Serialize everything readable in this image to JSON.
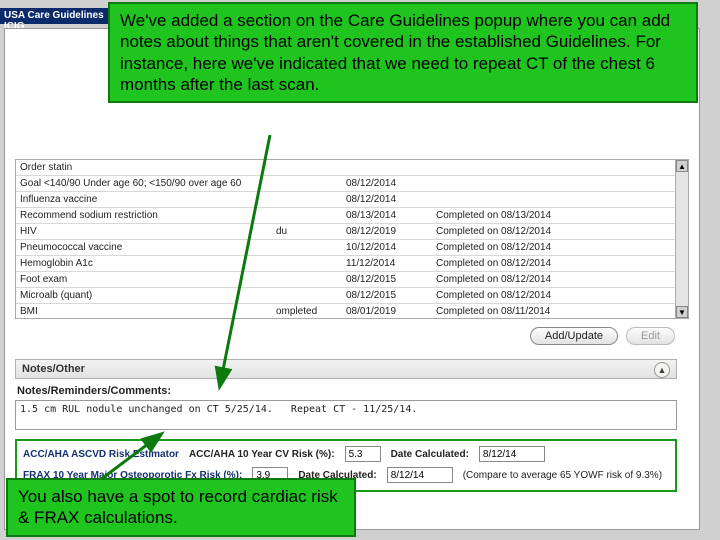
{
  "titlebar": "USA Care Guidelines ICIG",
  "callouts": {
    "top": "We've added a section on the Care Guidelines popup where you can add notes about things that aren't covered in the established Guidelines.  For instance, here we've indicated that we need to repeat CT of the chest 6 months after the last scan.",
    "bot": "You also have a spot to record cardiac risk & FRAX calculations."
  },
  "table_rows": [
    {
      "c1": "Order statin",
      "c2": "",
      "c3": "",
      "c4": ""
    },
    {
      "c1": "Goal <140/90 Under age 60; <150/90 over age 60",
      "c2": "",
      "c3": "08/12/2014",
      "c4": ""
    },
    {
      "c1": "Influenza vaccine",
      "c2": "",
      "c3": "08/12/2014",
      "c4": ""
    },
    {
      "c1": "Recommend sodium restriction",
      "c2": "",
      "c3": "08/13/2014",
      "c4": "Completed on 08/13/2014"
    },
    {
      "c1": "HIV",
      "c2": "du",
      "c3": "08/12/2019",
      "c4": "Completed on 08/12/2014"
    },
    {
      "c1": "Pneumococcal vaccine",
      "c2": "",
      "c3": "10/12/2014",
      "c4": "Completed on 08/12/2014"
    },
    {
      "c1": "Hemoglobin A1c",
      "c2": "",
      "c3": "11/12/2014",
      "c4": "Completed on 08/12/2014"
    },
    {
      "c1": "Foot exam",
      "c2": "",
      "c3": "08/12/2015",
      "c4": "Completed on 08/12/2014"
    },
    {
      "c1": "Microalb (quant)",
      "c2": "",
      "c3": "08/12/2015",
      "c4": "Completed on 08/12/2014"
    },
    {
      "c1": "BMI",
      "c2": "ompleted",
      "c3": "08/01/2019",
      "c4": "Completed on 08/11/2014"
    }
  ],
  "actions": {
    "add_update": "Add/Update",
    "edit": "Edit"
  },
  "notes": {
    "header": "Notes/Other",
    "sub": "Notes/Reminders/Comments:",
    "value": "1.5 cm RUL nodule unchanged on CT 5/25/14.   Repeat CT - 11/25/14."
  },
  "risk": {
    "row1": {
      "label": "ACC/AHA ASCVD Risk Estimator",
      "cv_label": "ACC/AHA 10 Year CV Risk (%):",
      "cv_value": "5.3",
      "date_label": "Date Calculated:",
      "date_value": "8/12/14"
    },
    "row2": {
      "label": "FRAX 10 Year Major Osteoporotic Fx Risk (%):",
      "frax_value": "3.9",
      "date_label": "Date Calculated:",
      "date_value": "8/12/14",
      "paren": "(Compare to average 65 YOWF risk of 9.3%)"
    }
  }
}
